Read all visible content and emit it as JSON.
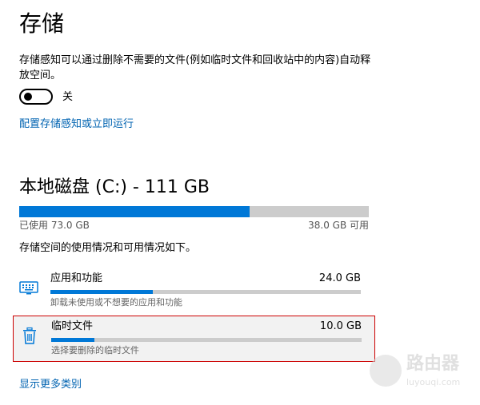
{
  "page": {
    "title": "存储"
  },
  "storage_sense": {
    "description": "存储感知可以通过删除不需要的文件(例如临时文件和回收站中的内容)自动释放空间。",
    "toggle_label": "关",
    "toggle_on": false,
    "configure_link": "配置存储感知或立即运行"
  },
  "drive": {
    "title": "本地磁盘 (C:) - 111 GB",
    "used_label": "已使用 73.0 GB",
    "free_label": "38.0 GB 可用",
    "used_fraction": 0.658,
    "intro": "存储空间的使用情况和可用情况如下。"
  },
  "categories": [
    {
      "name": "应用和功能",
      "size": "24.0 GB",
      "subtitle": "卸载未使用或不想要的应用和功能",
      "fraction": 0.33,
      "icon": "keyboard-icon"
    },
    {
      "name": "临时文件",
      "size": "10.0 GB",
      "subtitle": "选择要删除的临时文件",
      "fraction": 0.14,
      "icon": "trash-icon"
    }
  ],
  "more_link": "显示更多类别",
  "watermark": {
    "text": "路由器",
    "sub": "luyouqi.com"
  },
  "colors": {
    "accent": "#0078d7",
    "link": "#0063b1",
    "highlight_border": "#cc0000"
  }
}
